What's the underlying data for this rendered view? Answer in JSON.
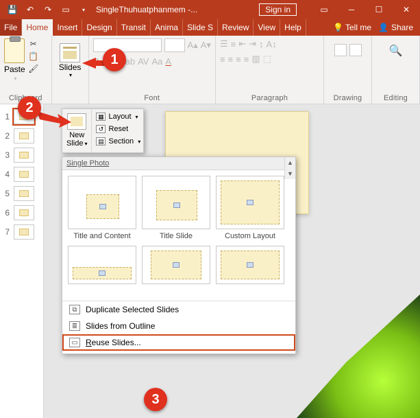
{
  "titlebar": {
    "docname": "SingleThuhuatphanmem  -...",
    "signin": "Sign in"
  },
  "tabs": {
    "file": "File",
    "home": "Home",
    "insert": "Insert",
    "design": "Design",
    "transit": "Transit",
    "anima": "Anima",
    "slides": "Slide S",
    "review": "Review",
    "view": "View",
    "help": "Help",
    "tellme": "Tell me",
    "share": "Share"
  },
  "ribbon": {
    "paste": "Paste",
    "clipboard": "Clipboard",
    "slides": "Slides",
    "font": "Font",
    "paragraph": "Paragraph",
    "drawing": "Drawing",
    "editing": "Editing",
    "fontSizePlaceholder": ""
  },
  "dropdown": {
    "newSlide": "New\nSlide",
    "layout": "Layout",
    "reset": "Reset",
    "section": "Section"
  },
  "gallery": {
    "header": "Single Photo",
    "layouts_row1": [
      {
        "name": "Title and Content"
      },
      {
        "name": "Title Slide"
      },
      {
        "name": "Custom Layout"
      }
    ],
    "layouts_row2": [
      {
        "name": ""
      },
      {
        "name": ""
      },
      {
        "name": ""
      }
    ],
    "footer": {
      "duplicate": "Duplicate Selected Slides",
      "outline": "Slides from Outline",
      "reuse": "Reuse Slides..."
    }
  },
  "thumbs": {
    "items": [
      {
        "n": "1"
      },
      {
        "n": "2"
      },
      {
        "n": "3"
      },
      {
        "n": "4"
      },
      {
        "n": "5"
      },
      {
        "n": "6"
      },
      {
        "n": "7"
      }
    ]
  },
  "badges": {
    "one": "1",
    "two": "2",
    "three": "3"
  }
}
